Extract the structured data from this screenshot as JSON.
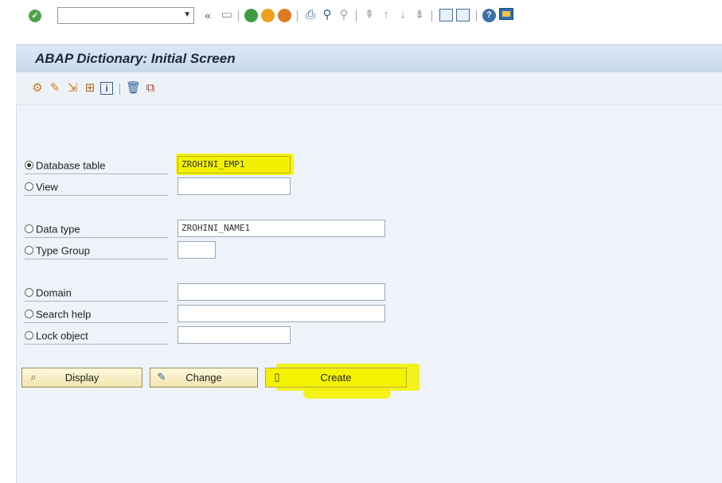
{
  "window": {
    "title": "ABAP Dictionary: Initial Screen"
  },
  "system_toolbar": {
    "command_field_value": "",
    "icons": [
      "checkmark-icon",
      "dropdown-icon",
      "double-chevron-icon",
      "save-icon",
      "back-icon",
      "exit-icon",
      "cancel-icon",
      "print-icon",
      "find-icon",
      "find-next-icon",
      "first-page-icon",
      "previous-page-icon",
      "next-page-icon",
      "last-page-icon",
      "new-session-icon",
      "shortcut-icon",
      "help-icon",
      "layout-icon"
    ]
  },
  "app_toolbar": {
    "icons": [
      "other-object-icon",
      "check-icon",
      "activate-icon",
      "where-used-icon",
      "info-icon",
      "delete-icon",
      "copy-icon"
    ]
  },
  "form": {
    "selected": "database_table",
    "options": [
      {
        "key": "database_table",
        "label": "Database table",
        "value": "ZROHINI_EMP1"
      },
      {
        "key": "view",
        "label": "View",
        "value": ""
      },
      {
        "key": "data_type",
        "label": "Data type",
        "value": "ZROHINI_NAME1"
      },
      {
        "key": "type_group",
        "label": "Type Group",
        "value": ""
      },
      {
        "key": "domain",
        "label": "Domain",
        "value": ""
      },
      {
        "key": "search_help",
        "label": "Search help",
        "value": ""
      },
      {
        "key": "lock_object",
        "label": "Lock object",
        "value": ""
      }
    ]
  },
  "buttons": {
    "display": "Display",
    "change": "Change",
    "create": "Create"
  },
  "colors": {
    "highlight": "#f4f200",
    "title_bar": "#c9d9ec",
    "content_bg": "#eef3f9",
    "button_bg": "#f2e5b0"
  }
}
